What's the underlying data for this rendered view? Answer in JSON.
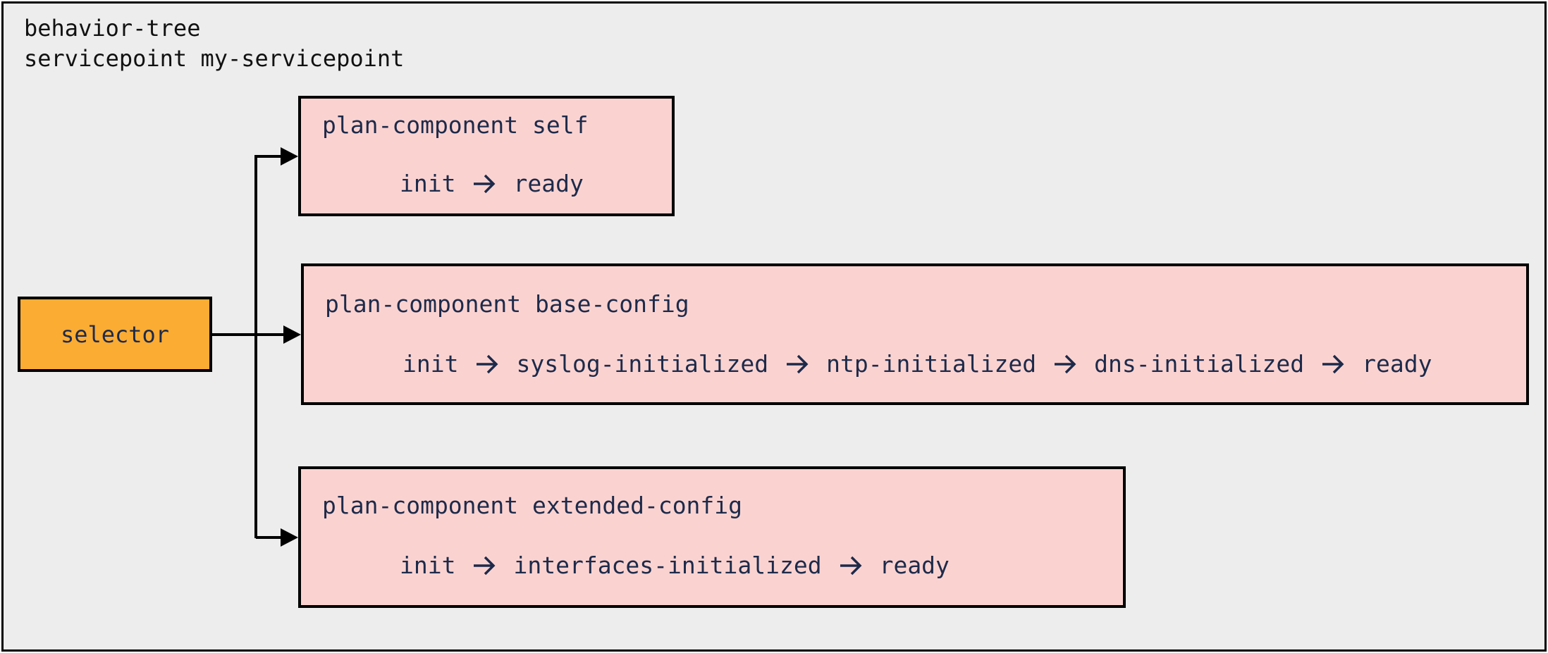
{
  "diagram": {
    "title_lines": [
      "behavior-tree",
      "servicepoint my-servicepoint"
    ],
    "selector": {
      "label": "selector"
    },
    "components": [
      {
        "title": "plan-component self",
        "states": [
          "init",
          "ready"
        ]
      },
      {
        "title": "plan-component base-config",
        "states": [
          "init",
          "syslog-initialized",
          "ntp-initialized",
          "dns-initialized",
          "ready"
        ]
      },
      {
        "title": "plan-component extended-config",
        "states": [
          "init",
          "interfaces-initialized",
          "ready"
        ]
      }
    ],
    "colors": {
      "background": "#ededed",
      "selector_fill": "#fbac33",
      "component_fill": "#fad3d1",
      "text": "#1d2a4a",
      "border": "#000000"
    },
    "icons": {
      "state_transition": "right-arrow-icon",
      "connector_head": "arrowhead-icon"
    }
  }
}
